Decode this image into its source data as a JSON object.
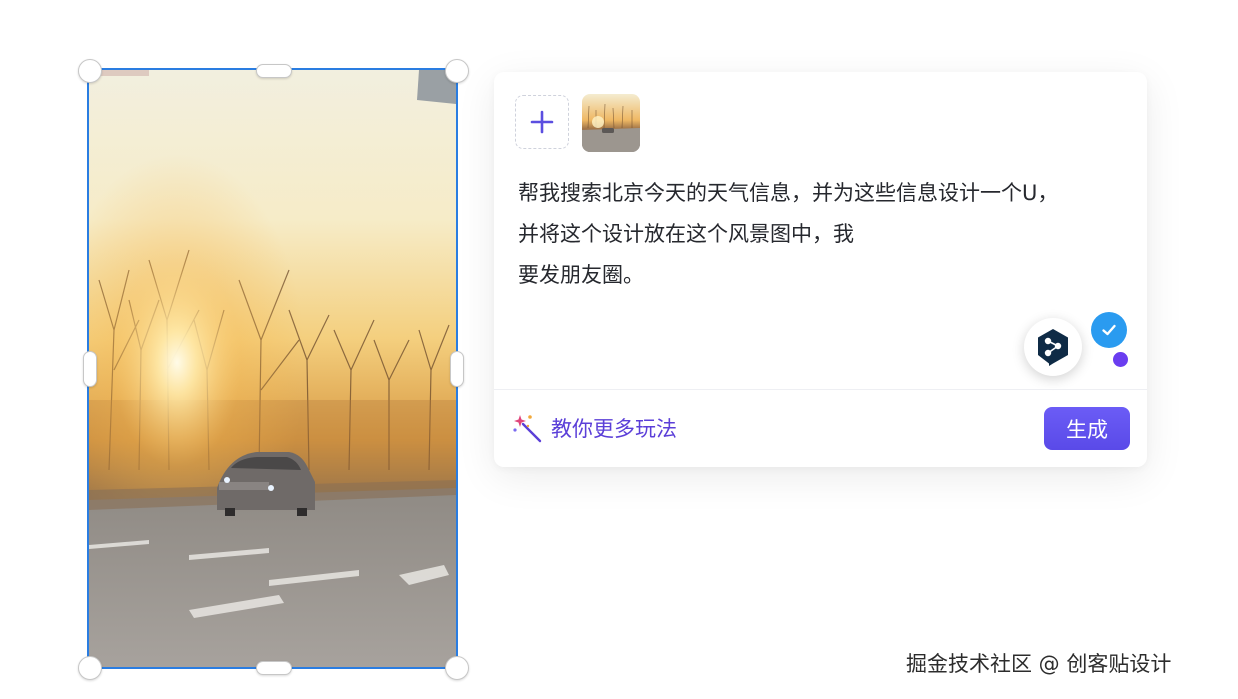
{
  "canvas": {
    "image": {
      "name": "beijing-sunset-landscape-photo",
      "selected": true
    }
  },
  "prompt_card": {
    "add_image_icon": "plus-icon",
    "attachment_thumbnail": "landscape-thumbnail",
    "prompt_lines": [
      "帮我搜索北京今天的天气信息，并为这些信息设计一个U，",
      "并将这个设计放在这个风景图中，我",
      "要发朋友圈。"
    ],
    "assistant_icon": "deepl-logo-icon",
    "status_icon": "check-icon",
    "tips_icon": "magic-wand-icon",
    "tips_label": "教你更多玩法",
    "generate_label": "生成",
    "colors": {
      "accent": "#5b3fd8",
      "button": "#6b5cf6",
      "check": "#2a9bf0",
      "selection": "#2a7de1"
    }
  },
  "watermark": "掘金技术社区 @ 创客贴设计"
}
